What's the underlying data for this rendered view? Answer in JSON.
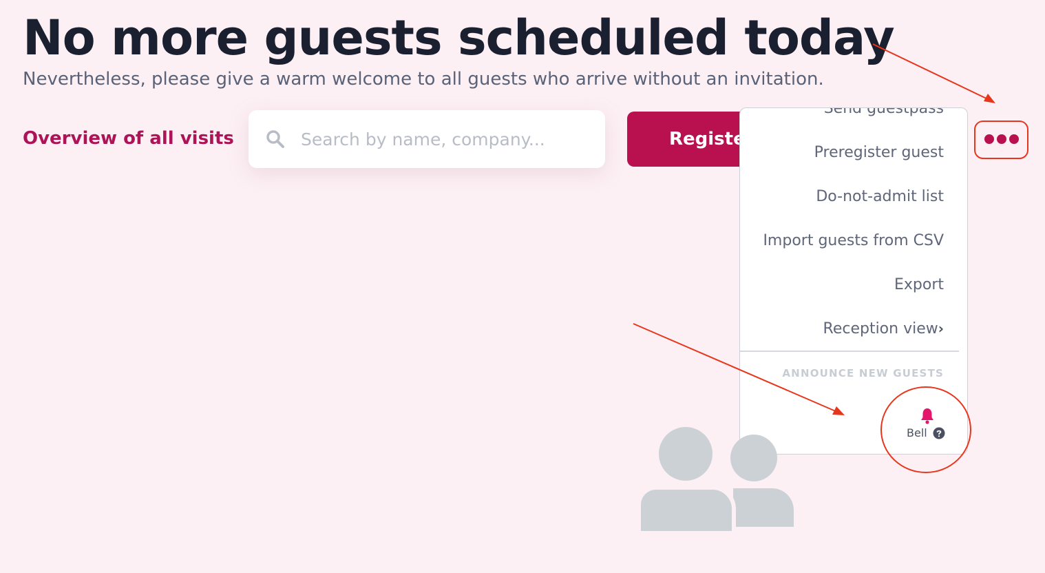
{
  "header": {
    "title": "No more guests scheduled today",
    "subtitle": "Nevertheless, please give a warm welcome to all guests who arrive without an invitation."
  },
  "toolbar": {
    "overview_link": "Overview of all visits",
    "search_placeholder": "Search by name, company...",
    "register_label": "Register"
  },
  "menu": {
    "items": [
      {
        "label": "Send guestpass"
      },
      {
        "label": "Preregister guest"
      },
      {
        "label": "Do-not-admit list"
      },
      {
        "label": "Import guests from CSV"
      },
      {
        "label": "Export"
      },
      {
        "label": "Reception view"
      }
    ],
    "section_label": "ANNOUNCE NEW GUESTS",
    "bell_label": "Bell"
  },
  "colors": {
    "accent": "#b9114f",
    "background": "#fcf0f4",
    "annotation": "#e8361d"
  },
  "icons": [
    "search-icon",
    "more-dots-icon",
    "chevron-right-icon",
    "bell-icon",
    "help-icon",
    "guests-illustration"
  ]
}
